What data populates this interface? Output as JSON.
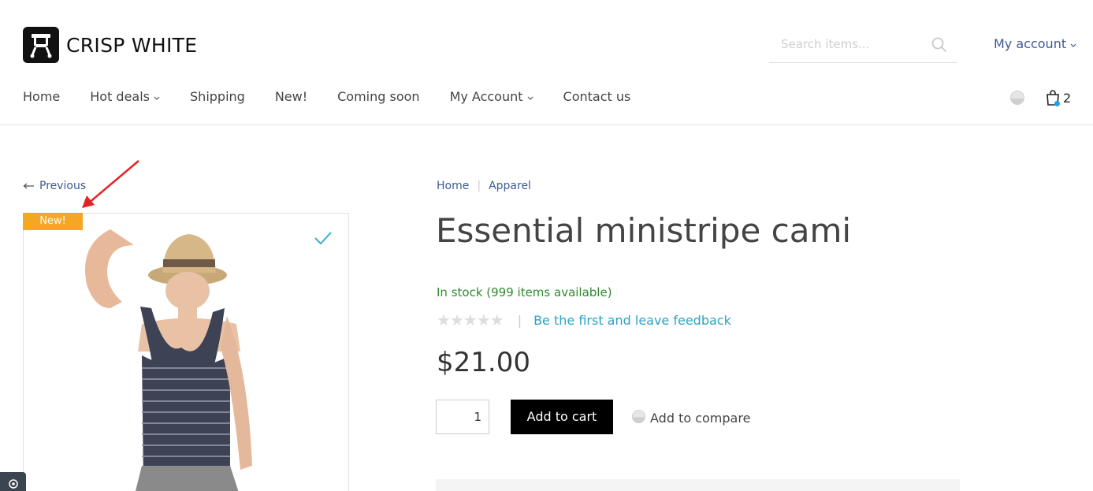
{
  "header": {
    "brand": "CRISP WHITE",
    "search_placeholder": "Search items...",
    "account_label": "My account"
  },
  "nav": {
    "items": [
      {
        "label": "Home",
        "has_dropdown": false
      },
      {
        "label": "Hot deals",
        "has_dropdown": true
      },
      {
        "label": "Shipping",
        "has_dropdown": false
      },
      {
        "label": "New!",
        "has_dropdown": false
      },
      {
        "label": "Coming soon",
        "has_dropdown": false
      },
      {
        "label": "My Account",
        "has_dropdown": true
      },
      {
        "label": "Contact us",
        "has_dropdown": false
      }
    ],
    "cart_count": "2"
  },
  "product": {
    "previous_label": "Previous",
    "badge": "New!",
    "breadcrumb": [
      "Home",
      "Apparel"
    ],
    "title": "Essential ministripe cami",
    "stock": "In stock (999 items available)",
    "rating_stars": 0,
    "feedback_link": "Be the first and leave feedback",
    "price": "$21.00",
    "quantity": "1",
    "add_to_cart": "Add to cart",
    "add_to_compare": "Add to compare"
  },
  "colors": {
    "accent_link": "#3d5b96",
    "feedback_link": "#2ba3c5",
    "in_stock": "#2e8b2e",
    "badge": "#f5a623",
    "cart_dot": "#1aa3e8",
    "annotation_arrow": "#e52222"
  }
}
